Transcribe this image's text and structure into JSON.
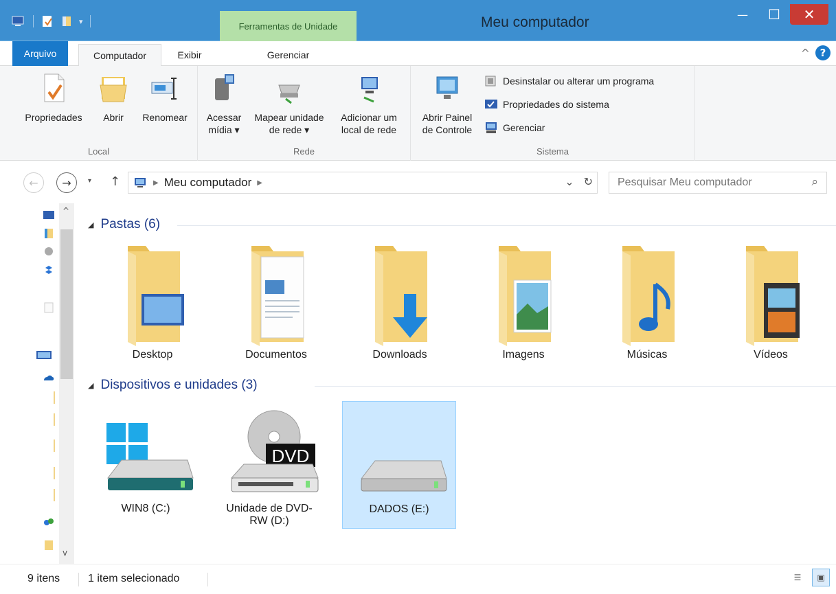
{
  "window": {
    "title": "Meu computador",
    "contextual_tab_group": "Ferramentas de Unidade",
    "minimize_glyph": "—",
    "maximize_glyph": "☐",
    "close_glyph": "✕"
  },
  "ribbon_tabs": {
    "arquivo": "Arquivo",
    "computador": "Computador",
    "exibir": "Exibir",
    "gerenciar": "Gerenciar"
  },
  "ribbon": {
    "groups": {
      "local": "Local",
      "rede": "Rede",
      "sistema": "Sistema"
    },
    "buttons": {
      "propriedades": "Propriedades",
      "abrir": "Abrir",
      "renomear": "Renomear",
      "acessar_midia": [
        "Acessar",
        "mídia ▾"
      ],
      "mapear_unidade": [
        "Mapear unidade",
        "de rede ▾"
      ],
      "adicionar_local": [
        "Adicionar um",
        "local de rede"
      ],
      "abrir_painel": [
        "Abrir Painel",
        "de Controle"
      ],
      "desinstalar": "Desinstalar ou alterar um programa",
      "propriedades_sistema": "Propriedades do sistema",
      "gerenciar": "Gerenciar"
    },
    "help_glyph": "?",
    "collapse_glyph": "^"
  },
  "address_bar": {
    "location": "Meu computador",
    "search_placeholder": "Pesquisar Meu computador",
    "back_glyph": "←",
    "forward_glyph": "→",
    "up_glyph": "↑",
    "refresh_glyph": "↻",
    "dropdown_glyph": "⌄",
    "search_glyph": "⌕"
  },
  "sections": {
    "folders": {
      "heading": "Pastas (6)",
      "items": [
        "Desktop",
        "Documentos",
        "Downloads",
        "Imagens",
        "Músicas",
        "Vídeos"
      ]
    },
    "devices": {
      "heading": "Dispositivos e unidades (3)",
      "items": [
        {
          "label": "WIN8 (C:)",
          "selected": false
        },
        {
          "label": "Unidade de DVD-RW (D:)",
          "selected": false,
          "badge": "DVD"
        },
        {
          "label": "DADOS (E:)",
          "selected": true
        }
      ]
    }
  },
  "status": {
    "items_count": "9 itens",
    "selected": "1 item selecionado"
  },
  "colors": {
    "titlebar": "#3d8fd0",
    "context_tab": "#b4e0a8",
    "file_tab": "#1979ca",
    "close_button": "#c83b34",
    "selection": "#cce8ff",
    "section_heading": "#1e3b8a",
    "folder": "#f4d37c"
  },
  "icons": {
    "folders": [
      "desktop-folder-icon",
      "documents-folder-icon",
      "downloads-folder-icon",
      "pictures-folder-icon",
      "music-folder-icon",
      "videos-folder-icon"
    ],
    "drives": [
      "windows-drive-icon",
      "dvd-drive-icon",
      "hard-drive-icon"
    ]
  }
}
